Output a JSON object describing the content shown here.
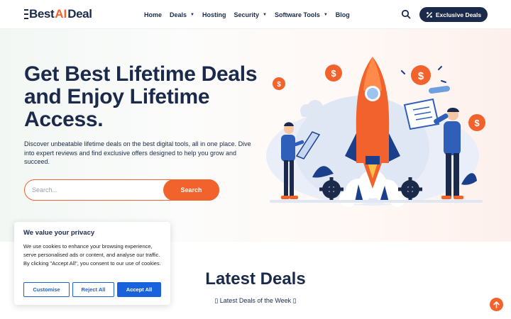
{
  "brand": {
    "logo_text_1": "Best",
    "logo_text_ai": "AI",
    "logo_text_2": "Deal"
  },
  "nav": {
    "items": [
      {
        "label": "Home",
        "dropdown": false
      },
      {
        "label": "Deals",
        "dropdown": true
      },
      {
        "label": "Hosting",
        "dropdown": false
      },
      {
        "label": "Security",
        "dropdown": true
      },
      {
        "label": "Software Tools",
        "dropdown": true
      },
      {
        "label": "Blog",
        "dropdown": false
      }
    ],
    "search_icon": "search-icon",
    "cta_label": "Exclusive Deals",
    "cta_icon": "percent-tag-icon"
  },
  "hero": {
    "title": "Get Best Lifetime Deals and Enjoy Lifetime Access.",
    "description": "Discover unbeatable lifetime deals on the best digital tools, all in one place. Dive into expert reviews and find exclusive offers designed to help you grow and succeed.",
    "search_placeholder": "Search...",
    "search_button": "Search"
  },
  "latest": {
    "title": "Latest Deals",
    "subtitle": "▯ Latest Deals of the Week ▯"
  },
  "cookie": {
    "title": "We value your privacy",
    "text": "We use cookies to enhance your browsing experience, serve personalised ads or content, and analyse our traffic. By clicking \"Accept All\", you consent to our use of cookies.",
    "customise": "Customise",
    "reject": "Reject All",
    "accept": "Accept All"
  },
  "colors": {
    "navy": "#1b2a4a",
    "orange": "#f2622c",
    "cookie_blue": "#1863dc"
  },
  "scroll_top_icon": "arrow-up-icon"
}
